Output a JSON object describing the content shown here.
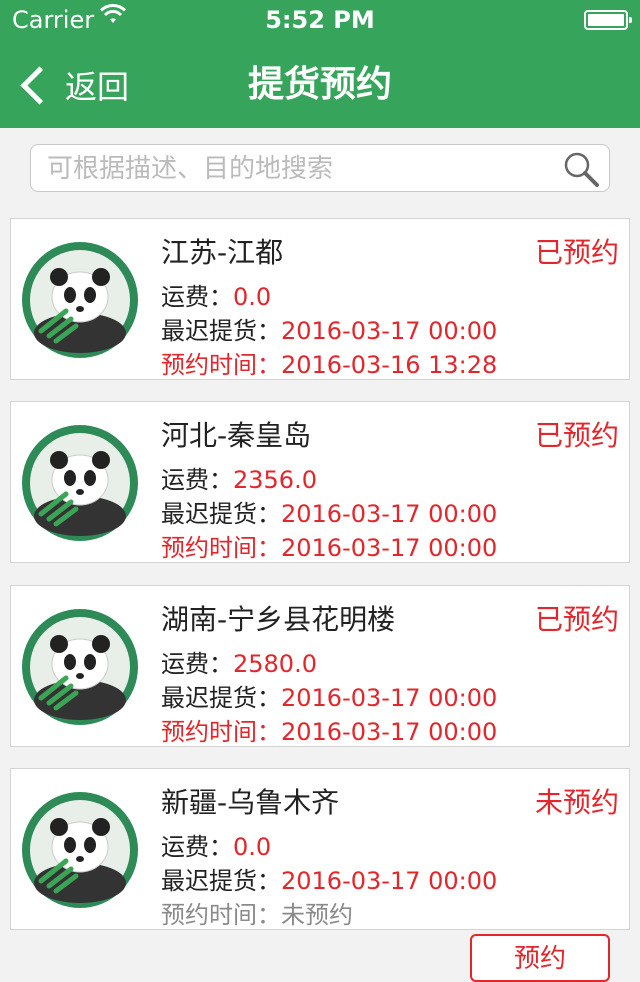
{
  "status_bar": {
    "carrier": "Carrier",
    "time": "5:52 PM"
  },
  "nav": {
    "back_label": "返回",
    "title": "提货预约"
  },
  "search": {
    "placeholder": "可根据描述、目的地搜索",
    "value": ""
  },
  "labels": {
    "freight": "运费：",
    "latest_pickup": "最迟提货：",
    "reserve_time": "预约时间："
  },
  "orders": [
    {
      "destination": "江苏-江都",
      "status": "已预约",
      "freight": "0.0",
      "latest_pickup": "2016-03-17 00:00",
      "reserve_time": "2016-03-16 13:28"
    },
    {
      "destination": "河北-秦皇岛",
      "status": "已预约",
      "freight": "2356.0",
      "latest_pickup": "2016-03-17 00:00",
      "reserve_time": "2016-03-17 00:00"
    },
    {
      "destination": "湖南-宁乡县花明楼",
      "status": "已预约",
      "freight": "2580.0",
      "latest_pickup": "2016-03-17 00:00",
      "reserve_time": "2016-03-17 00:00"
    },
    {
      "destination": "新疆-乌鲁木齐",
      "status": "未预约",
      "freight": "0.0",
      "latest_pickup": "2016-03-17 00:00",
      "reserve_time": "未预约"
    }
  ],
  "reserve_button": "预约",
  "colors": {
    "header": "#36a45a",
    "accent_red": "#e3262c"
  }
}
